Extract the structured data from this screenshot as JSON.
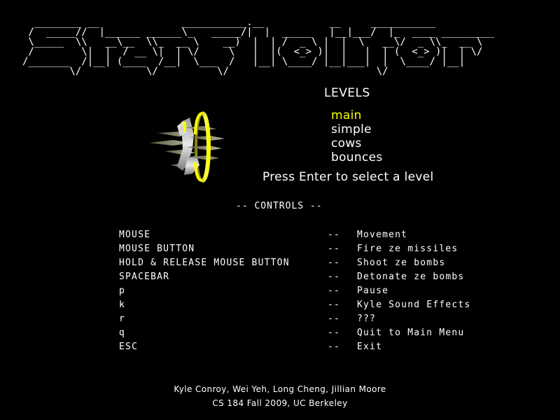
{
  "title": {
    "ascii_lines": [
      "  ________ __              ___________.__           __     ___________",
      " /  _____//  |______ ______\\_   _____/|  |  _____   |__|___/  |_  ____ _________ ",
      " \\_____  \\\\   __\\__  \\\\_  __ \\    __)  |  | /  _ \\ |  |  \\   __\\/  _ \\\\_  __ \\",
      " /        \\|  |  / __ \\|  | \\/     \\   |  |(  <_> )|  |   |  | (  <_> )|  | \\/",
      "/_______  /|__| (____  /__|  \\___  /   |__| \\____/ |__|___|  |  \\____/ |__|   ",
      "        \\/           \\/          \\/                         \\/                  "
    ]
  },
  "levels": {
    "heading": "LEVELS",
    "items": [
      "main",
      "simple",
      "cows",
      "bounces"
    ],
    "selected_index": 0,
    "prompt": "Press Enter to select a level"
  },
  "controls": {
    "heading": "-- CONTROLS --",
    "rows": [
      {
        "key": "MOUSE",
        "sep": "--",
        "action": "Movement"
      },
      {
        "key": "MOUSE BUTTON",
        "sep": "--",
        "action": "Fire ze missiles"
      },
      {
        "key": "HOLD & RELEASE MOUSE BUTTON",
        "sep": "--",
        "action": "Shoot ze bombs"
      },
      {
        "key": "SPACEBAR",
        "sep": "--",
        "action": "Detonate ze bombs"
      },
      {
        "key": "p",
        "sep": "--",
        "action": "Pause"
      },
      {
        "key": "k",
        "sep": "--",
        "action": "Kyle Sound Effects"
      },
      {
        "key": "r",
        "sep": "--",
        "action": "???"
      },
      {
        "key": "q",
        "sep": "--",
        "action": "Quit to Main Menu"
      },
      {
        "key": "ESC",
        "sep": "--",
        "action": "Exit"
      }
    ]
  },
  "credits": {
    "authors": "Kyle Conroy, Wei Yeh, Long Cheng, Jillian Moore",
    "course": "CS 184 Fall 2009, UC Berkeley"
  },
  "colors": {
    "background": "#000000",
    "text": "#ffffff",
    "highlight": "#ffff00"
  },
  "icons": {
    "ship": "spaceship-icon"
  }
}
